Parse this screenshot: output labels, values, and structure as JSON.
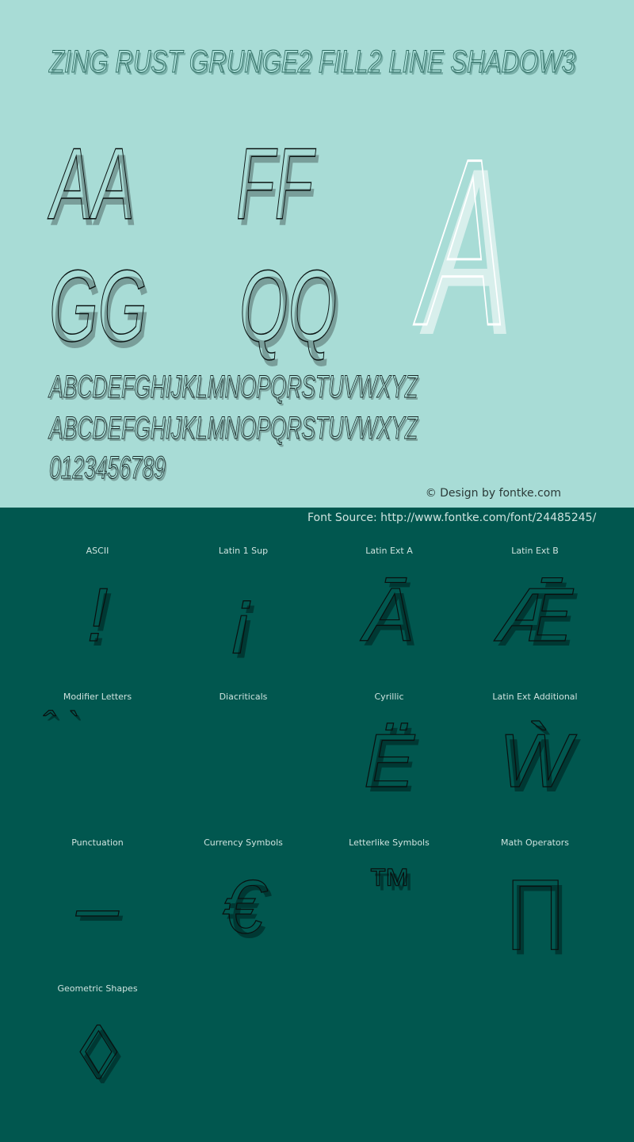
{
  "colors": {
    "top_background": "#a8dcd6",
    "bottom_background": "#01574f",
    "glyph_ink": "#0a0f0e",
    "hero_glyph": "#ffffff",
    "label_text": "#cfe3df"
  },
  "header": {
    "font_name": "ZING RUST GRUNGE2 FILL2 LINE SHADOW3"
  },
  "preview": {
    "pairs": [
      "AA",
      "FF",
      "GG",
      "QQ"
    ],
    "hero_glyph": "A",
    "uppercase_row_1": "ABCDEFGHIJKLMNOPQRSTUVWXYZ",
    "uppercase_row_2": "ABCDEFGHIJKLMNOPQRSTUVWXYZ",
    "digits_row": "0123456789"
  },
  "credit": "© Design by fontke.com",
  "source": "Font Source: http://www.fontke.com/font/24485245/",
  "charsets": [
    {
      "label": "ASCII",
      "glyph": "!"
    },
    {
      "label": "Latin 1 Sup",
      "glyph": "¡"
    },
    {
      "label": "Latin Ext A",
      "glyph": "Ā"
    },
    {
      "label": "Latin Ext B",
      "glyph": "Ǣ"
    },
    {
      "label": "Modifier Letters",
      "glyph": "ˆ ˋ"
    },
    {
      "label": "Diacriticals",
      "glyph": ""
    },
    {
      "label": "Cyrillic",
      "glyph": "Ё"
    },
    {
      "label": "Latin Ext Additional",
      "glyph": "Ẁ"
    },
    {
      "label": "Punctuation",
      "glyph": "–"
    },
    {
      "label": "Currency Symbols",
      "glyph": "€"
    },
    {
      "label": "Letterlike Symbols",
      "glyph": "™"
    },
    {
      "label": "Math Operators",
      "glyph": "∏"
    },
    {
      "label": "Geometric Shapes",
      "glyph": "◊"
    }
  ]
}
